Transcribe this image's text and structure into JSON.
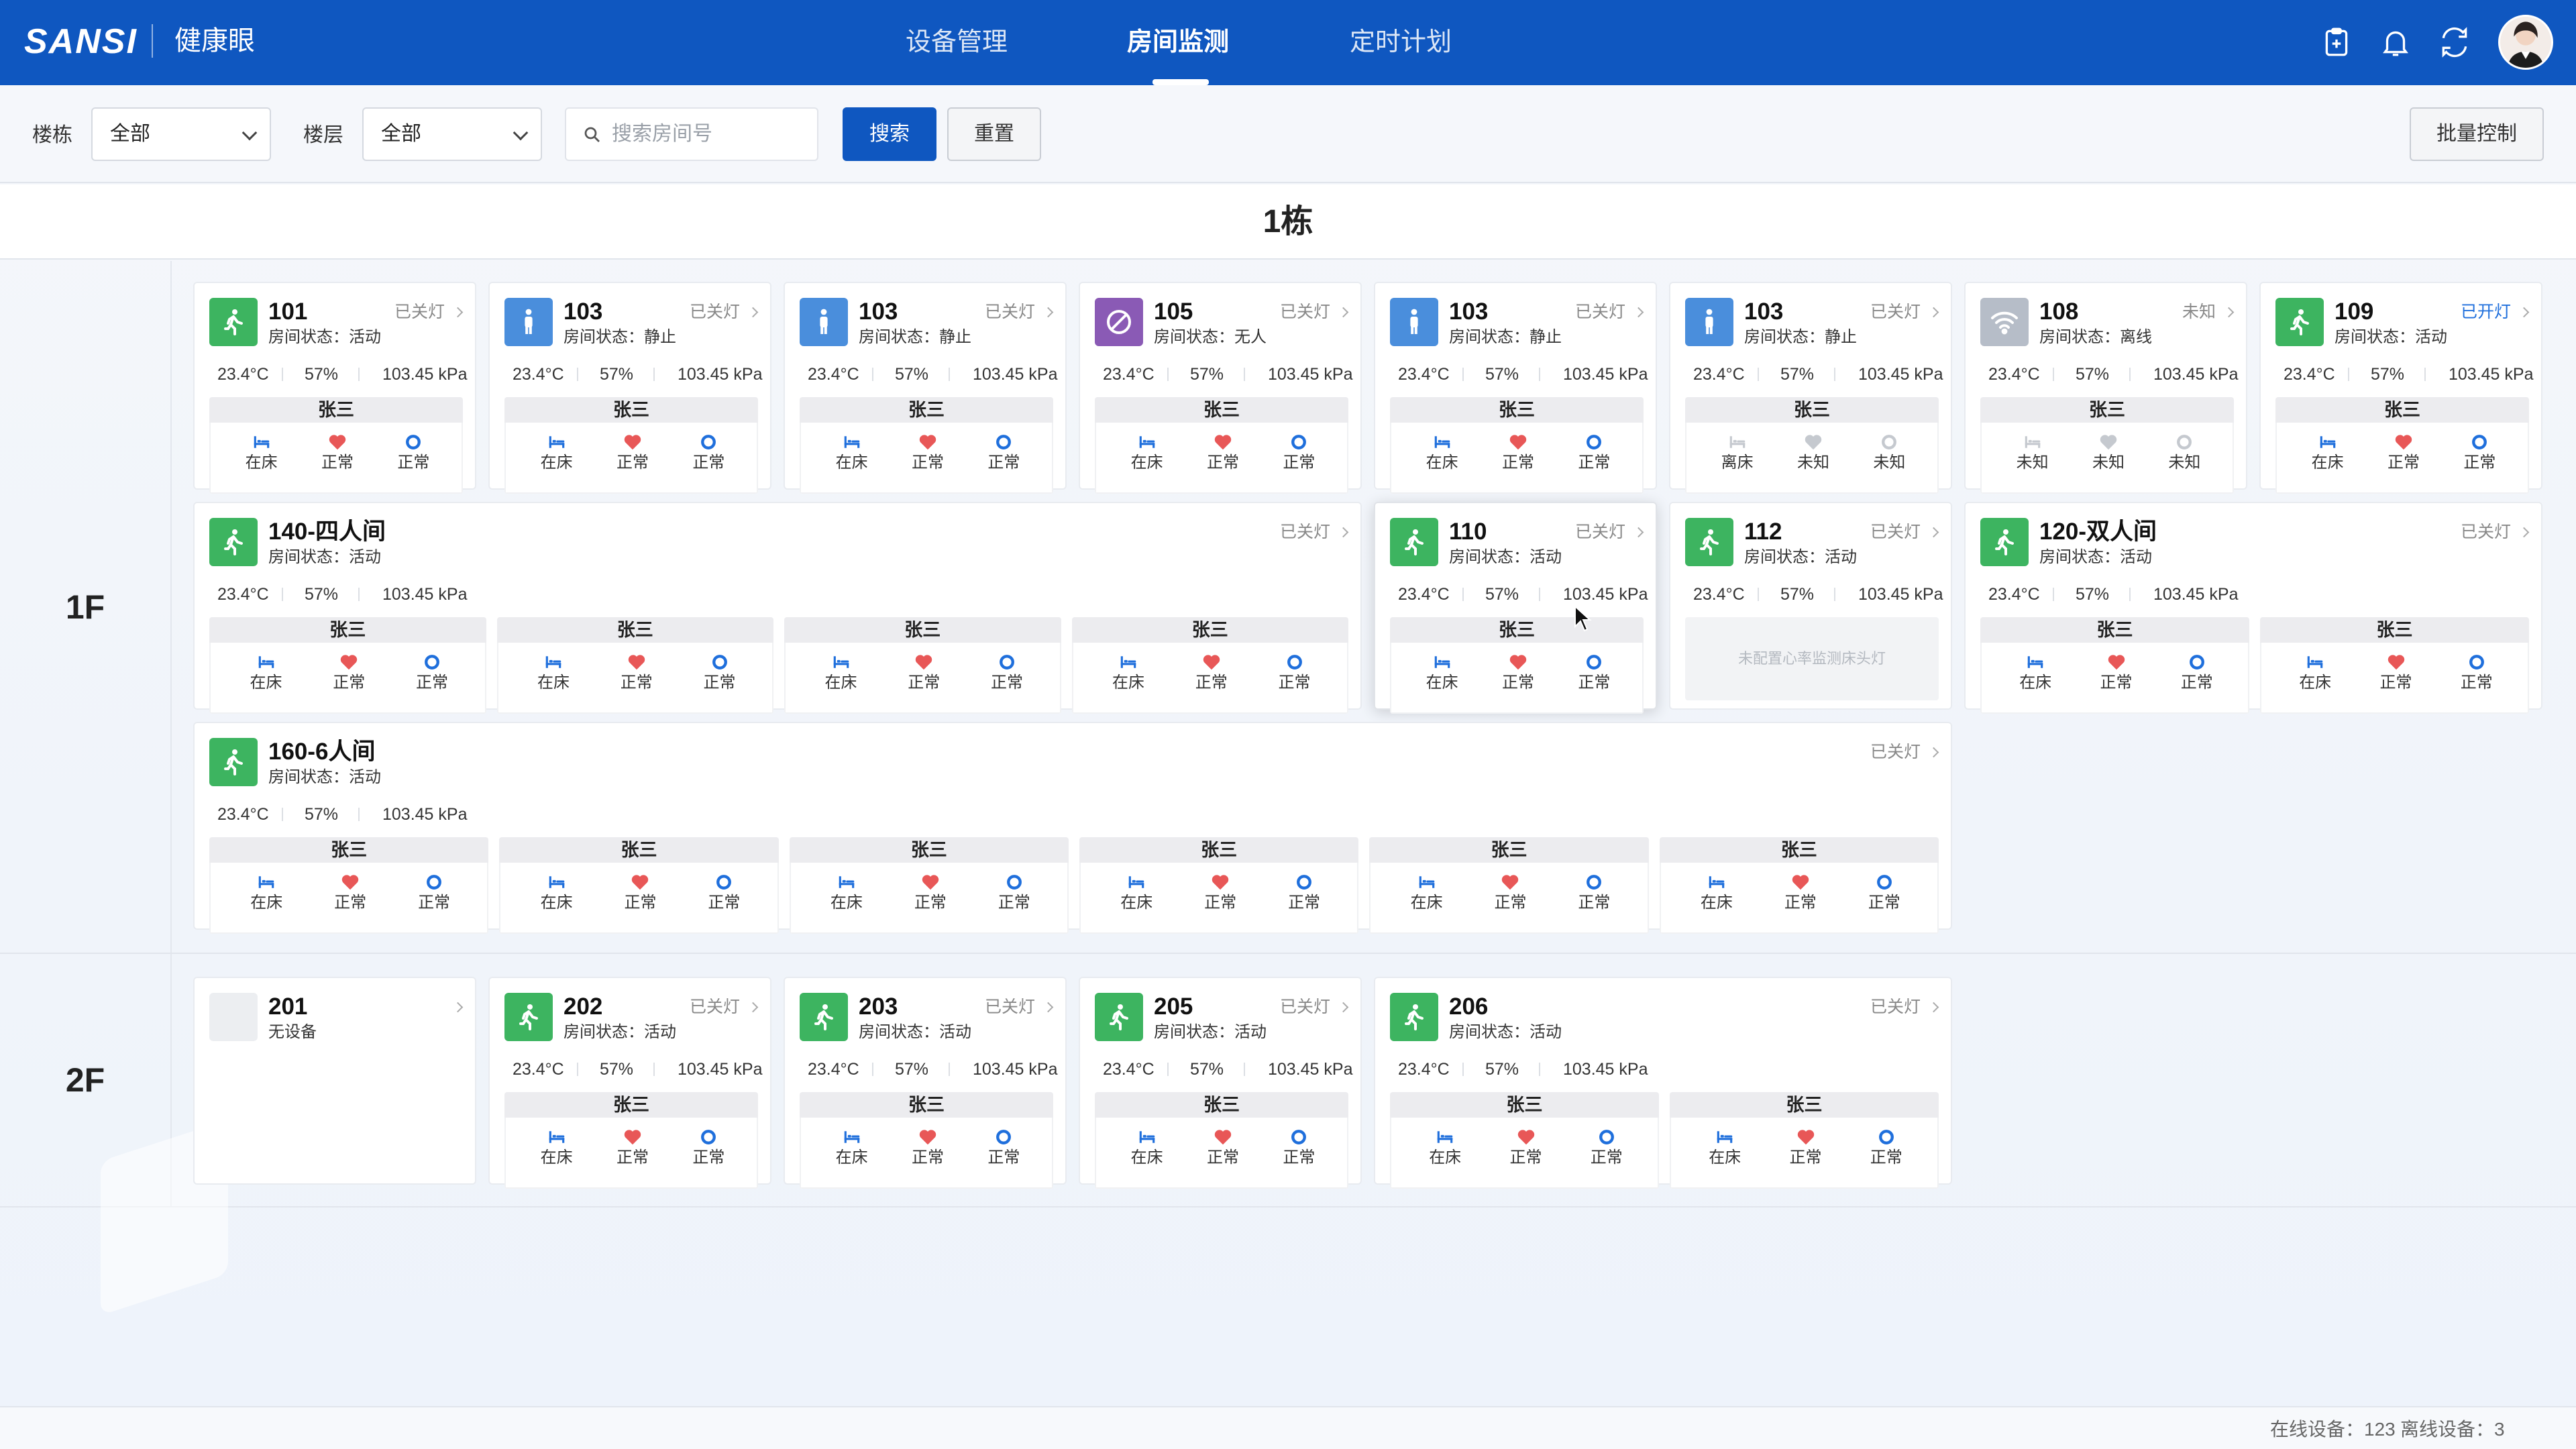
{
  "header": {
    "logo": "SANSI",
    "app_name": "健康眼",
    "nav": [
      {
        "label": "设备管理",
        "active": false
      },
      {
        "label": "房间监测",
        "active": true
      },
      {
        "label": "定时计划",
        "active": false
      }
    ],
    "icons": [
      "clipboard-icon",
      "bell-icon",
      "translate-icon"
    ],
    "brand_color": "#0f57c0"
  },
  "filters": {
    "building_label": "楼栋",
    "building_value": "全部",
    "floor_label": "楼层",
    "floor_value": "全部",
    "search_placeholder": "搜索房间号",
    "search_button": "搜索",
    "reset_button": "重置",
    "batch_button": "批量控制"
  },
  "building_title": "1栋",
  "floors": [
    {
      "label": "1F",
      "cards": [
        {
          "room": "101",
          "state_label": "房间状态：",
          "state": "活动",
          "icon": "walking-person-icon",
          "icon_color": "green",
          "lamp": "已关灯",
          "temp": "23.4°C",
          "humidity": "57%",
          "pressure": "103.45 kPa",
          "beds": [
            {
              "name": "张三",
              "bed_status": "在床",
              "heart": "正常",
              "breath": "正常"
            }
          ]
        },
        {
          "room": "103",
          "state_label": "房间状态：",
          "state": "静止",
          "icon": "standing-person-icon",
          "icon_color": "blue",
          "lamp": "已关灯",
          "temp": "23.4°C",
          "humidity": "57%",
          "pressure": "103.45 kPa",
          "beds": [
            {
              "name": "张三",
              "bed_status": "在床",
              "heart": "正常",
              "breath": "正常"
            }
          ]
        },
        {
          "room": "103",
          "state_label": "房间状态：",
          "state": "静止",
          "icon": "standing-person-icon",
          "icon_color": "blue",
          "lamp": "已关灯",
          "temp": "23.4°C",
          "humidity": "57%",
          "pressure": "103.45 kPa",
          "beds": [
            {
              "name": "张三",
              "bed_status": "在床",
              "heart": "正常",
              "breath": "正常"
            }
          ]
        },
        {
          "room": "105",
          "state_label": "房间状态：",
          "state": "无人",
          "icon": "no-person-icon",
          "icon_color": "purple",
          "lamp": "已关灯",
          "temp": "23.4°C",
          "humidity": "57%",
          "pressure": "103.45 kPa",
          "beds": [
            {
              "name": "张三",
              "bed_status": "在床",
              "heart": "正常",
              "breath": "正常"
            }
          ]
        },
        {
          "room": "103",
          "state_label": "房间状态：",
          "state": "静止",
          "icon": "standing-person-icon",
          "icon_color": "blue",
          "lamp": "已关灯",
          "temp": "23.4°C",
          "humidity": "57%",
          "pressure": "103.45 kPa",
          "beds": [
            {
              "name": "张三",
              "bed_status": "在床",
              "heart": "正常",
              "breath": "正常"
            }
          ]
        },
        {
          "room": "103",
          "state_label": "房间状态：",
          "state": "静止",
          "icon": "standing-person-icon",
          "icon_color": "blue",
          "lamp": "已关灯",
          "temp": "23.4°C",
          "humidity": "57%",
          "pressure": "103.45 kPa",
          "beds": [
            {
              "name": "张三",
              "bed_status": "离床",
              "heart": "未知",
              "breath": "未知"
            }
          ]
        },
        {
          "room": "108",
          "state_label": "房间状态：",
          "state": "离线",
          "icon": "wifi-offline-icon",
          "icon_color": "gray",
          "lamp": "未知",
          "temp": "23.4°C",
          "humidity": "57%",
          "pressure": "103.45 kPa",
          "beds": [
            {
              "name": "张三",
              "bed_status": "未知",
              "heart": "未知",
              "breath": "未知"
            }
          ]
        },
        {
          "room": "109",
          "state_label": "房间状态：",
          "state": "活动",
          "icon": "walking-person-icon",
          "icon_color": "green",
          "lamp": "已开灯",
          "lamp_on": true,
          "temp": "23.4°C",
          "humidity": "57%",
          "pressure": "103.45 kPa",
          "beds": [
            {
              "name": "张三",
              "bed_status": "在床",
              "heart": "正常",
              "breath": "正常"
            }
          ]
        },
        {
          "room": "140-四人间",
          "state_label": "房间状态：",
          "state": "活动",
          "icon": "walking-person-icon",
          "icon_color": "green",
          "lamp": "已关灯",
          "temp": "23.4°C",
          "humidity": "57%",
          "pressure": "103.45 kPa",
          "beds": [
            {
              "name": "张三",
              "bed_status": "在床",
              "heart": "正常",
              "breath": "正常"
            },
            {
              "name": "张三",
              "bed_status": "在床",
              "heart": "正常",
              "breath": "正常"
            },
            {
              "name": "张三",
              "bed_status": "在床",
              "heart": "正常",
              "breath": "正常"
            },
            {
              "name": "张三",
              "bed_status": "在床",
              "heart": "正常",
              "breath": "正常"
            }
          ]
        },
        {
          "room": "110",
          "state_label": "房间状态：",
          "state": "活动",
          "icon": "walking-person-icon",
          "icon_color": "green",
          "lamp": "已关灯",
          "highlight": true,
          "temp": "23.4°C",
          "humidity": "57%",
          "pressure": "103.45 kPa",
          "beds": [
            {
              "name": "张三",
              "bed_status": "在床",
              "heart": "正常",
              "breath": "正常"
            }
          ]
        },
        {
          "room": "112",
          "state_label": "房间状态：",
          "state": "活动",
          "icon": "walking-person-icon",
          "icon_color": "green",
          "lamp": "已关灯",
          "temp": "23.4°C",
          "humidity": "57%",
          "pressure": "103.45 kPa",
          "beds": [],
          "no_device_note": "未配置心率监测床头灯"
        },
        {
          "room": "120-双人间",
          "state_label": "房间状态：",
          "state": "活动",
          "icon": "walking-person-icon",
          "icon_color": "green",
          "lamp": "已关灯",
          "temp": "23.4°C",
          "humidity": "57%",
          "pressure": "103.45 kPa",
          "beds": [
            {
              "name": "张三",
              "bed_status": "在床",
              "heart": "正常",
              "breath": "正常"
            },
            {
              "name": "张三",
              "bed_status": "在床",
              "heart": "正常",
              "breath": "正常"
            }
          ]
        },
        {
          "room": "160-6人间",
          "state_label": "房间状态：",
          "state": "活动",
          "icon": "walking-person-icon",
          "icon_color": "green",
          "lamp": "已关灯",
          "temp": "23.4°C",
          "humidity": "57%",
          "pressure": "103.45 kPa",
          "beds": [
            {
              "name": "张三",
              "bed_status": "在床",
              "heart": "正常",
              "breath": "正常"
            },
            {
              "name": "张三",
              "bed_status": "在床",
              "heart": "正常",
              "breath": "正常"
            },
            {
              "name": "张三",
              "bed_status": "在床",
              "heart": "正常",
              "breath": "正常"
            },
            {
              "name": "张三",
              "bed_status": "在床",
              "heart": "正常",
              "breath": "正常"
            },
            {
              "name": "张三",
              "bed_status": "在床",
              "heart": "正常",
              "breath": "正常"
            },
            {
              "name": "张三",
              "bed_status": "在床",
              "heart": "正常",
              "breath": "正常"
            }
          ]
        }
      ]
    },
    {
      "label": "2F",
      "cards": [
        {
          "room": "201",
          "state": "无设备",
          "icon": "empty-icon",
          "icon_color": "empty",
          "no_device": true,
          "beds": []
        },
        {
          "room": "202",
          "state_label": "房间状态：",
          "state": "活动",
          "icon": "walking-person-icon",
          "icon_color": "green",
          "lamp": "已关灯",
          "temp": "23.4°C",
          "humidity": "57%",
          "pressure": "103.45 kPa",
          "beds": [
            {
              "name": "张三",
              "bed_status": "在床",
              "heart": "正常",
              "breath": "正常"
            }
          ]
        },
        {
          "room": "203",
          "state_label": "房间状态：",
          "state": "活动",
          "icon": "walking-person-icon",
          "icon_color": "green",
          "lamp": "已关灯",
          "temp": "23.4°C",
          "humidity": "57%",
          "pressure": "103.45 kPa",
          "beds": [
            {
              "name": "张三",
              "bed_status": "在床",
              "heart": "正常",
              "breath": "正常"
            }
          ]
        },
        {
          "room": "205",
          "state_label": "房间状态：",
          "state": "活动",
          "icon": "walking-person-icon",
          "icon_color": "green",
          "lamp": "已关灯",
          "temp": "23.4°C",
          "humidity": "57%",
          "pressure": "103.45 kPa",
          "beds": [
            {
              "name": "张三",
              "bed_status": "在床",
              "heart": "正常",
              "breath": "正常"
            }
          ]
        },
        {
          "room": "206",
          "state_label": "房间状态：",
          "state": "活动",
          "icon": "walking-person-icon",
          "icon_color": "green",
          "lamp": "已关灯",
          "temp": "23.4°C",
          "humidity": "57%",
          "pressure": "103.45 kPa",
          "beds": [
            {
              "name": "张三",
              "bed_status": "在床",
              "heart": "正常",
              "breath": "正常"
            },
            {
              "name": "张三",
              "bed_status": "在床",
              "heart": "正常",
              "breath": "正常"
            }
          ]
        }
      ]
    }
  ],
  "footer": {
    "online": "在线设备：123",
    "offline": "离线设备：3"
  },
  "colors": {
    "active_green": "#3db460",
    "still_blue": "#4a8edc",
    "empty_purple": "#8a5ab5",
    "offline_gray": "#b6bdc8",
    "heart_red": "#e85757",
    "breath_blue": "#1f6fdc"
  }
}
